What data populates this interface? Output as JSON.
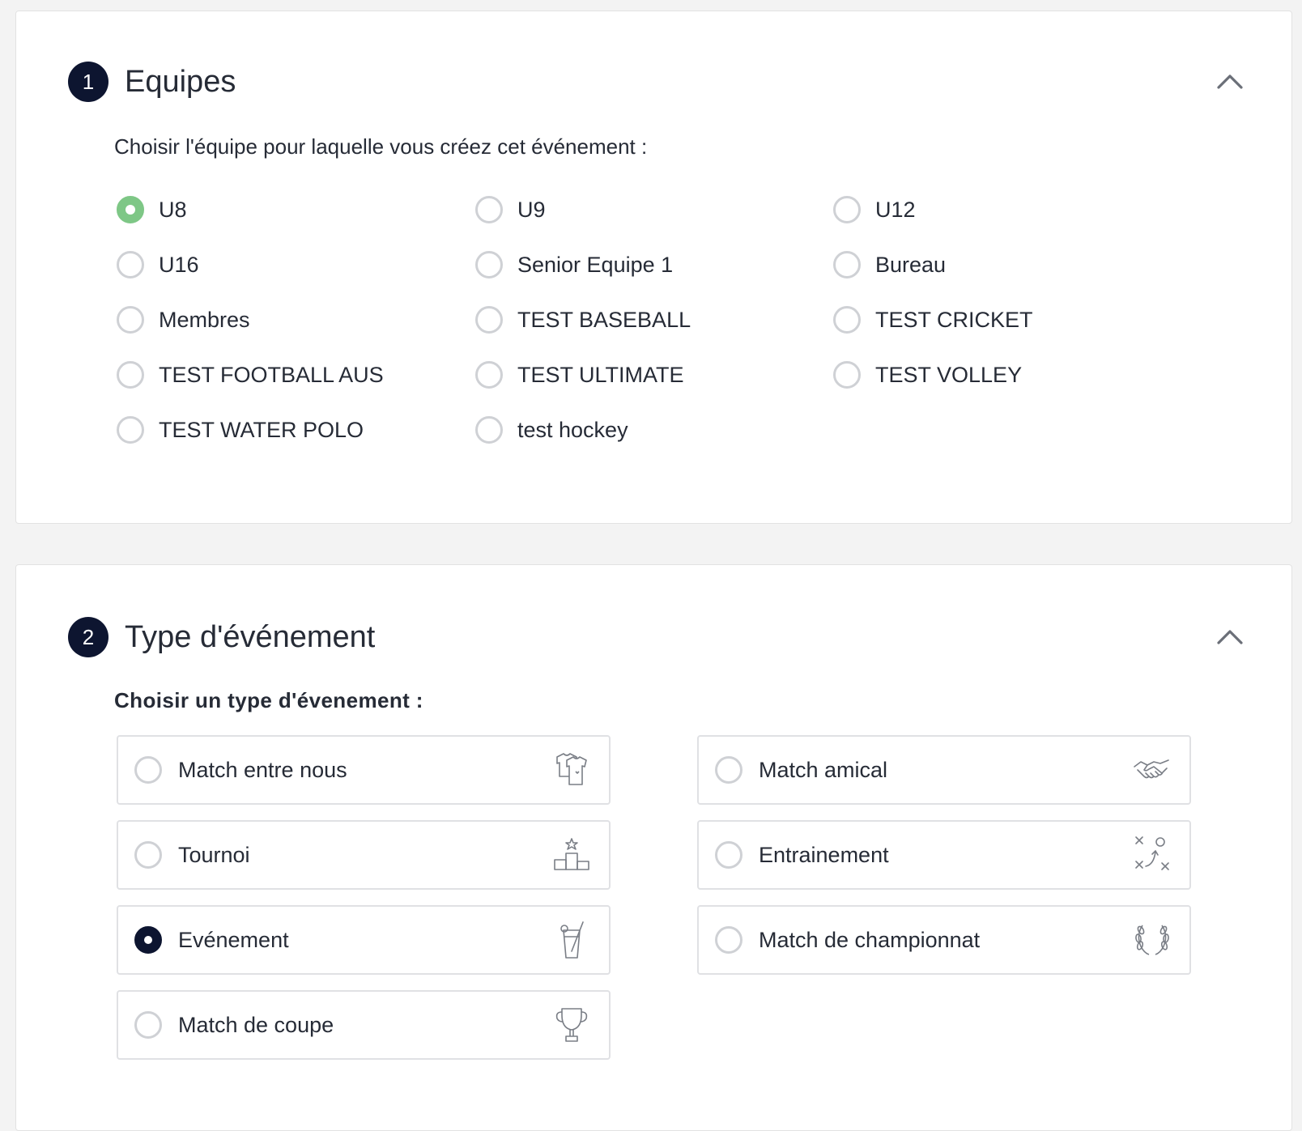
{
  "section1": {
    "step": "1",
    "title": "Equipes",
    "subtitle": "Choisir l'équipe pour laquelle vous créez cet événement :",
    "selected": "U8",
    "teams": [
      "U8",
      "U9",
      "U12",
      "U16",
      "Senior Equipe 1",
      "Bureau",
      "Membres",
      "TEST BASEBALL",
      "TEST CRICKET",
      "TEST FOOTBALL AUS",
      "TEST ULTIMATE",
      "TEST VOLLEY",
      "TEST WATER POLO",
      "test hockey"
    ]
  },
  "section2": {
    "step": "2",
    "title": "Type d'événement",
    "subtitle": "Choisir un type d'évenement :",
    "selected": "Evénement",
    "types": [
      {
        "label": "Match entre nous",
        "icon": "jersey-icon"
      },
      {
        "label": "Match amical",
        "icon": "handshake-icon"
      },
      {
        "label": "Tournoi",
        "icon": "podium-icon"
      },
      {
        "label": "Entrainement",
        "icon": "tactics-board-icon"
      },
      {
        "label": "Evénement",
        "icon": "cocktail-icon"
      },
      {
        "label": "Match de championnat",
        "icon": "laurel-icon"
      },
      {
        "label": "Match de coupe",
        "icon": "trophy-icon"
      }
    ]
  },
  "colors": {
    "accent_dark": "#0d1530",
    "selected_green": "#7ec786",
    "radio_border": "#cfd1d5"
  }
}
